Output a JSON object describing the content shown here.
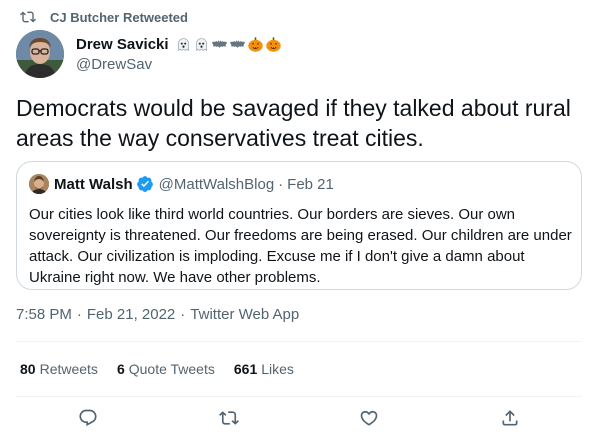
{
  "retweet_context": {
    "label": "CJ Butcher Retweeted"
  },
  "author": {
    "name": "Drew Savicki",
    "handle": "@DrewSav",
    "name_emojis": [
      "ghost",
      "ghost",
      "bat",
      "bat",
      "jack-o-lantern",
      "jack-o-lantern"
    ]
  },
  "tweet": {
    "text": "Democrats would be savaged if they talked about rural areas the way conservatives treat cities."
  },
  "quoted_tweet": {
    "name": "Matt Walsh",
    "handle": "@MattWalshBlog",
    "separator": "·",
    "date": "Feb 21",
    "verified": true,
    "text": "Our cities look like third world countries. Our borders are sieves. Our own sovereignty is threatened. Our freedoms are being erased. Our children are under attack. Our civilization is imploding. Excuse me if I don't give a damn about Ukraine right now. We have other problems."
  },
  "meta": {
    "time": "7:58 PM",
    "separator": "·",
    "date": "Feb 21, 2022",
    "source": "Twitter Web App"
  },
  "stats": {
    "retweets_count": "80",
    "retweets_label": "Retweets",
    "quote_count": "6",
    "quote_label": "Quote Tweets",
    "likes_count": "661",
    "likes_label": "Likes"
  },
  "actions": {
    "icons": [
      "reply-icon",
      "retweet-icon",
      "like-icon",
      "share-icon"
    ]
  },
  "colors": {
    "text_primary": "#0f1419",
    "text_secondary": "#536471",
    "border": "#cfd9de",
    "divider": "#eff3f4",
    "verified": "#1d9bf0",
    "pumpkin": "#f4900c"
  }
}
